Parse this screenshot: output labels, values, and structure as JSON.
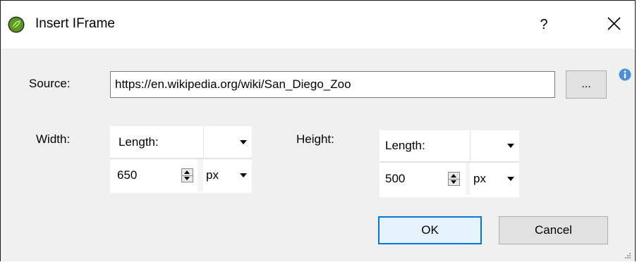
{
  "window": {
    "title": "Insert IFrame",
    "help_label": "?",
    "close_icon": "close-icon",
    "app_icon": "leaf-logo-icon"
  },
  "source": {
    "label": "Source:",
    "value": "https://en.wikipedia.org/wiki/San_Diego_Zoo",
    "browse_label": "...",
    "info_icon": "info-icon"
  },
  "width": {
    "label": "Width:",
    "type_value": "Length:",
    "type_extra": "",
    "amount": "650",
    "unit": "px"
  },
  "height": {
    "label": "Height:",
    "type_value": "Length:",
    "type_extra": "",
    "amount": "500",
    "unit": "px"
  },
  "buttons": {
    "ok": "OK",
    "cancel": "Cancel"
  },
  "colors": {
    "accent": "#0078d7",
    "logo": "#5a9a1e",
    "info": "#4a90d9"
  }
}
